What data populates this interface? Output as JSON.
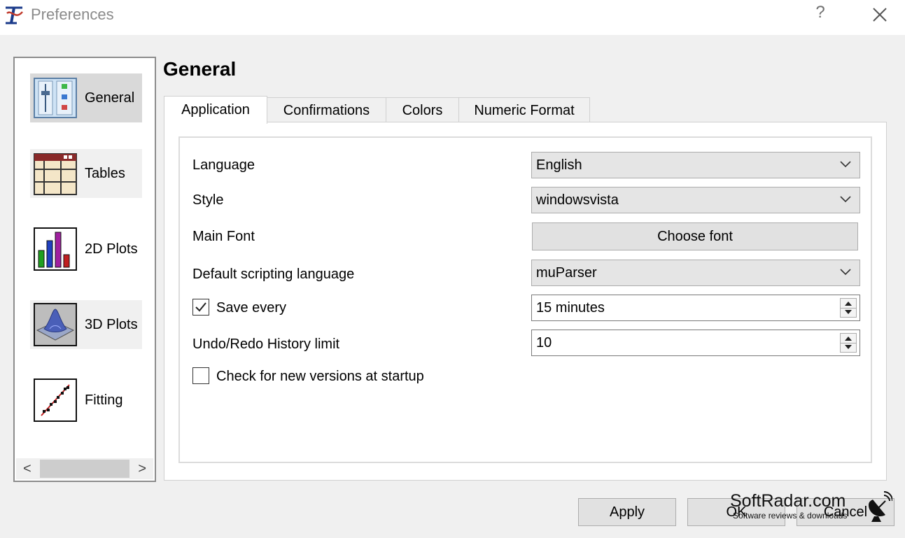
{
  "window": {
    "title": "Preferences",
    "help_label": "?",
    "close_icon": "close-icon",
    "app_icon": "qtiplot-logo-icon"
  },
  "sidebar": {
    "items": [
      {
        "label": "General",
        "icon": "general-settings-icon",
        "selected": true
      },
      {
        "label": "Tables",
        "icon": "tables-icon",
        "selected": false
      },
      {
        "label": "2D Plots",
        "icon": "bar-chart-icon",
        "selected": false
      },
      {
        "label": "3D Plots",
        "icon": "surface-plot-icon",
        "selected": false
      },
      {
        "label": "Fitting",
        "icon": "fitting-icon",
        "selected": false
      }
    ],
    "scroll_left": "<",
    "scroll_right": ">"
  },
  "main": {
    "title": "General",
    "tabs": [
      {
        "label": "Application",
        "active": true
      },
      {
        "label": "Confirmations",
        "active": false
      },
      {
        "label": "Colors",
        "active": false
      },
      {
        "label": "Numeric Format",
        "active": false
      }
    ],
    "form": {
      "language_label": "Language",
      "language_value": "English",
      "style_label": "Style",
      "style_value": "windowsvista",
      "main_font_label": "Main Font",
      "choose_font_button": "Choose font",
      "scripting_label": "Default scripting language",
      "scripting_value": "muParser",
      "save_every_label": "Save every",
      "save_every_checked": true,
      "save_every_value": "15 minutes",
      "undo_label": "Undo/Redo History limit",
      "undo_value": "10",
      "check_versions_label": "Check for new versions at startup",
      "check_versions_checked": false
    }
  },
  "buttons": {
    "apply": "Apply",
    "ok": "OK",
    "cancel": "Cancel"
  },
  "watermark": {
    "title": "SoftRadar.com",
    "subtitle": "Software reviews & downloads"
  },
  "colors": {
    "selected_item_bg": "#d9d9d9",
    "window_bg": "#f0f0f0",
    "title_text": "#8a8a8a"
  }
}
